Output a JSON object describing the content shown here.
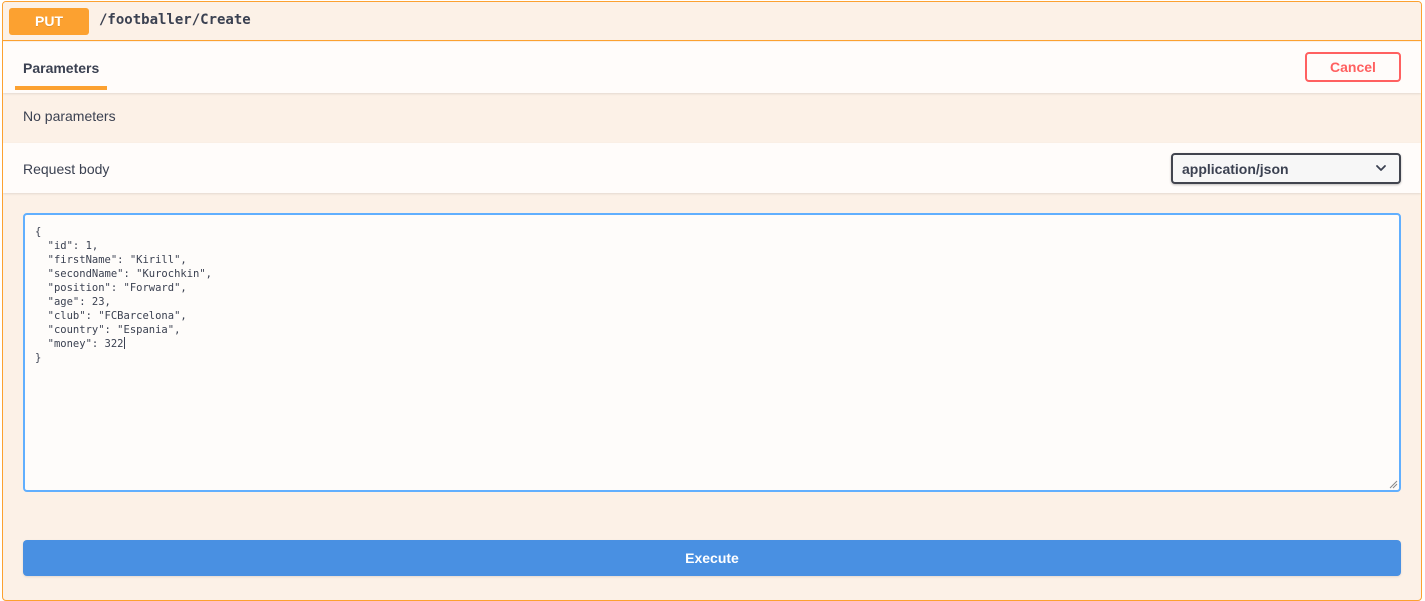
{
  "operation": {
    "method": "PUT",
    "path": "/footballer/Create"
  },
  "parameters": {
    "tab_label": "Parameters",
    "cancel_label": "Cancel",
    "empty_message": "No parameters"
  },
  "request_body": {
    "label": "Request body",
    "content_type": "application/json",
    "lines": [
      "{",
      "  \"id\": 1,",
      "  \"firstName\": \"Kirill\",",
      "  \"secondName\": \"Kurochkin\",",
      "  \"position\": \"Forward\",",
      "  \"age\": 23,",
      "  \"club\": \"FCBarcelona\",",
      "  \"country\": \"Espania\",",
      "  \"money\": 322",
      "}"
    ]
  },
  "actions": {
    "execute_label": "Execute"
  },
  "colors": {
    "put_accent": "#fca130",
    "cancel": "#ff6060",
    "execute": "#4990e2",
    "editor_focus": "#61affe"
  },
  "icons": {
    "select_arrow": "chevron-down-icon",
    "resize_handle": "resize-handle-icon"
  }
}
